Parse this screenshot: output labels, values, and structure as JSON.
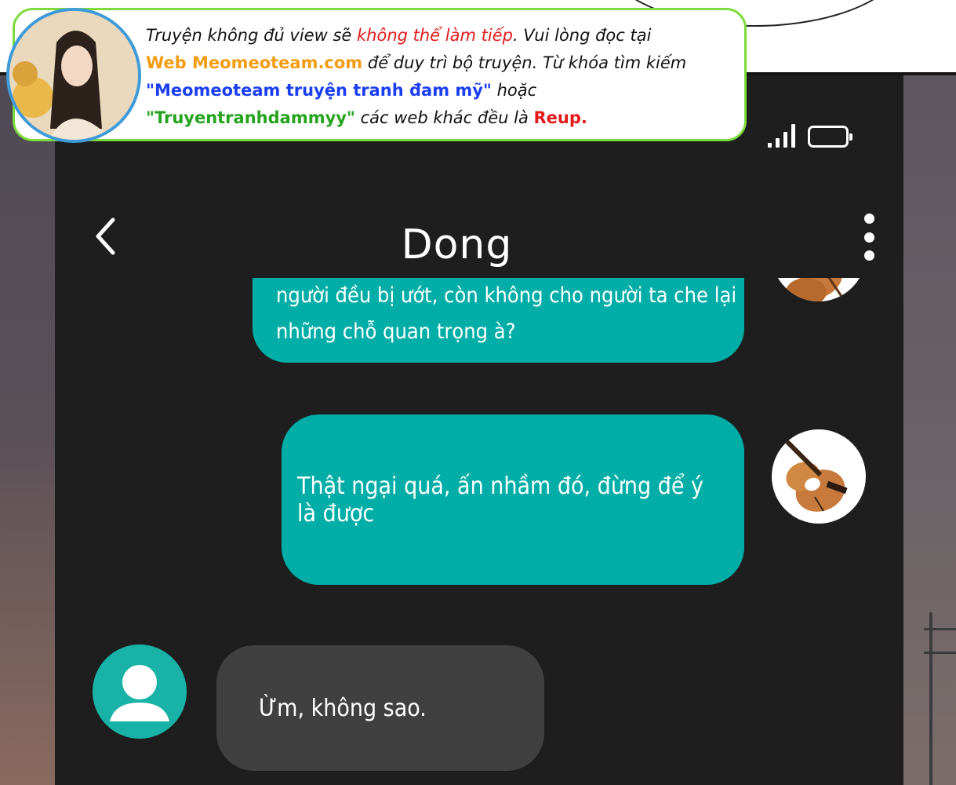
{
  "banner": {
    "line1_a": "Truyện không đủ view sẽ ",
    "line1_b": "không thể làm tiếp",
    "line1_c": ". Vui lòng đọc tại",
    "line2_a": "Web Meomeoteam.com",
    "line2_b": " để duy trì bộ truyện. Từ khóa tìm kiếm",
    "line3_a": "\"Meomeoteam truyện tranh đam mỹ\"",
    "line3_b": " hoặc",
    "line4_a": "\"Truyentranhdammyy\"",
    "line4_b": " các web khác đều là ",
    "line4_c": "Reup."
  },
  "header": {
    "contact_name": "Dong"
  },
  "messages": [
    {
      "direction": "outgoing",
      "text_line1": "người đều bị ướt, còn không cho người ta che lại",
      "text_line2": "những chỗ quan trọng à?"
    },
    {
      "direction": "outgoing",
      "text": "Thật ngại quá, ấn nhầm đó, đừng để ý là được"
    },
    {
      "direction": "incoming",
      "text": "Ừm, không sao."
    }
  ],
  "colors": {
    "outgoing_bubble": "#00aea7",
    "incoming_bubble": "#404040",
    "chat_background": "#1e1e1e",
    "banner_border": "#7ddc3c"
  },
  "icons": [
    "back-chevron-icon",
    "more-vertical-icon",
    "signal-icon",
    "battery-icon",
    "violin-avatar",
    "person-avatar-icon"
  ]
}
